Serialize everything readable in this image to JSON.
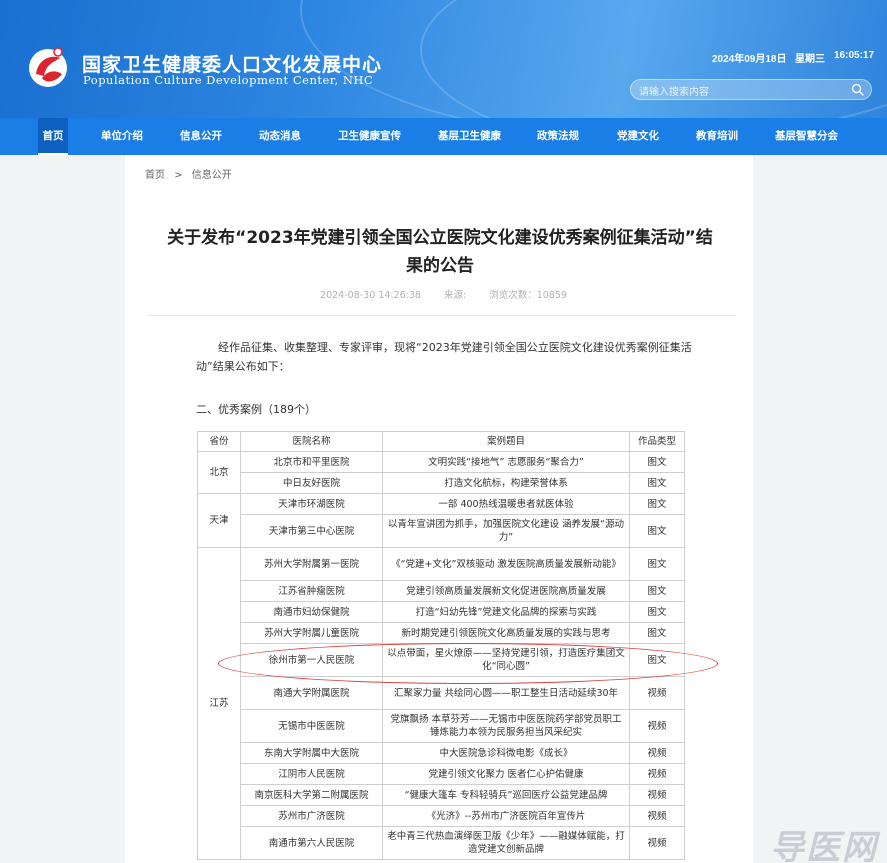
{
  "header": {
    "title": "国家卫生健康委人口文化发展中心",
    "subtitle": "Population Culture Development Center, NHC",
    "date": "2024年09月18日",
    "weekday": "星期三",
    "time": "16:05:17",
    "search_placeholder": "请输入搜索内容"
  },
  "nav": {
    "items": [
      {
        "label": "首页"
      },
      {
        "label": "单位介绍"
      },
      {
        "label": "信息公开"
      },
      {
        "label": "动态消息"
      },
      {
        "label": "卫生健康宣传"
      },
      {
        "label": "基层卫生健康"
      },
      {
        "label": "政策法规"
      },
      {
        "label": "党建文化"
      },
      {
        "label": "教育培训"
      },
      {
        "label": "基层智慧分会"
      }
    ]
  },
  "breadcrumb": {
    "home": "首页",
    "sep": ">",
    "current": "信息公开"
  },
  "article": {
    "title_line1": "关于发布“2023年党建引领全国公立医院文化建设优秀案例征集活动”结",
    "title_line2": "果的公告",
    "datetime": "2024-08-30 14:26:38",
    "source": "来源:",
    "views": "浏览次数：10859",
    "intro": "经作品征集、收集整理、专家评审，现将“2023年党建引领全国公立医院文化建设优秀案例征集活动”结果公布如下：",
    "section": "二、优秀案例（189个）"
  },
  "table": {
    "headers": {
      "province": "省份",
      "hospital": "医院名称",
      "topic": "案例题目",
      "type": "作品类型"
    },
    "beijing": {
      "province": "北京",
      "rows": [
        {
          "hospital": "北京市和平里医院",
          "topic": "文明实践“接地气” 志愿服务“聚合力”",
          "type": "图文"
        },
        {
          "hospital": "中日友好医院",
          "topic": "打造文化航标，构建荣誉体系",
          "type": "图文"
        }
      ]
    },
    "tianjin": {
      "province": "天津",
      "rows": [
        {
          "hospital": "天津市环湖医院",
          "topic": "一部 400热线温暖患者就医体验",
          "type": "图文"
        },
        {
          "hospital": "天津市第三中心医院",
          "topic": "以青年宣讲团为抓手，加强医院文化建设 涵养发展“源动力”",
          "type": "图文"
        }
      ]
    },
    "jiangsu": {
      "province": "江苏",
      "rows": [
        {
          "hospital": "苏州大学附属第一医院",
          "topic": "《“党建+文化”双核驱动 激发医院高质量发展新动能》",
          "type": "图文"
        },
        {
          "hospital": "江苏省肿瘤医院",
          "topic": "党建引领高质量发展新文化促进医院高质量发展",
          "type": "图文"
        },
        {
          "hospital": "南通市妇幼保健院",
          "topic": "打造“妇幼先锋”党建文化品牌的探索与实践",
          "type": "图文"
        },
        {
          "hospital": "苏州大学附属儿童医院",
          "topic": "新时期党建引领医院文化高质量发展的实践与思考",
          "type": "图文"
        },
        {
          "hospital": "徐州市第一人民医院",
          "topic": "以点带面，星火燎原——坚持党建引领，打造医疗集团文化“同心圆”",
          "type": "图文"
        },
        {
          "hospital": "南通大学附属医院",
          "topic": "汇聚家力量 共绘同心圆——职工整生日活动延续30年",
          "type": "视频"
        },
        {
          "hospital": "无锡市中医医院",
          "topic": "党旗飘扬 本草芬芳——无锡市中医医院药学部党员职工锤炼能力本领为民服务担当风采纪实",
          "type": "视频"
        },
        {
          "hospital": "东南大学附属中大医院",
          "topic": "中大医院急诊科微电影《成长》",
          "type": "视频"
        },
        {
          "hospital": "江阴市人民医院",
          "topic": "党建引领文化聚力 医者仁心护佑健康",
          "type": "视频"
        },
        {
          "hospital": "南京医科大学第二附属医院",
          "topic": "“健康大篷车 专科轻骑兵”巡回医疗公益党建品牌",
          "type": "视频"
        },
        {
          "hospital": "苏州市广济医院",
          "topic": "《光济》--苏州市广济医院百年宣传片",
          "type": "视频"
        },
        {
          "hospital": "南通市第六人民医院",
          "topic": "老中青三代热血演绎医卫版《少年》——融媒体赋能，打造党建文创新品牌",
          "type": "视频"
        }
      ]
    }
  },
  "watermark": "导医网",
  "colors": {
    "header": "#2d86e0",
    "nav": "#1a7ee6",
    "nav_active": "#0d5fc0",
    "highlight": "#d94040"
  }
}
